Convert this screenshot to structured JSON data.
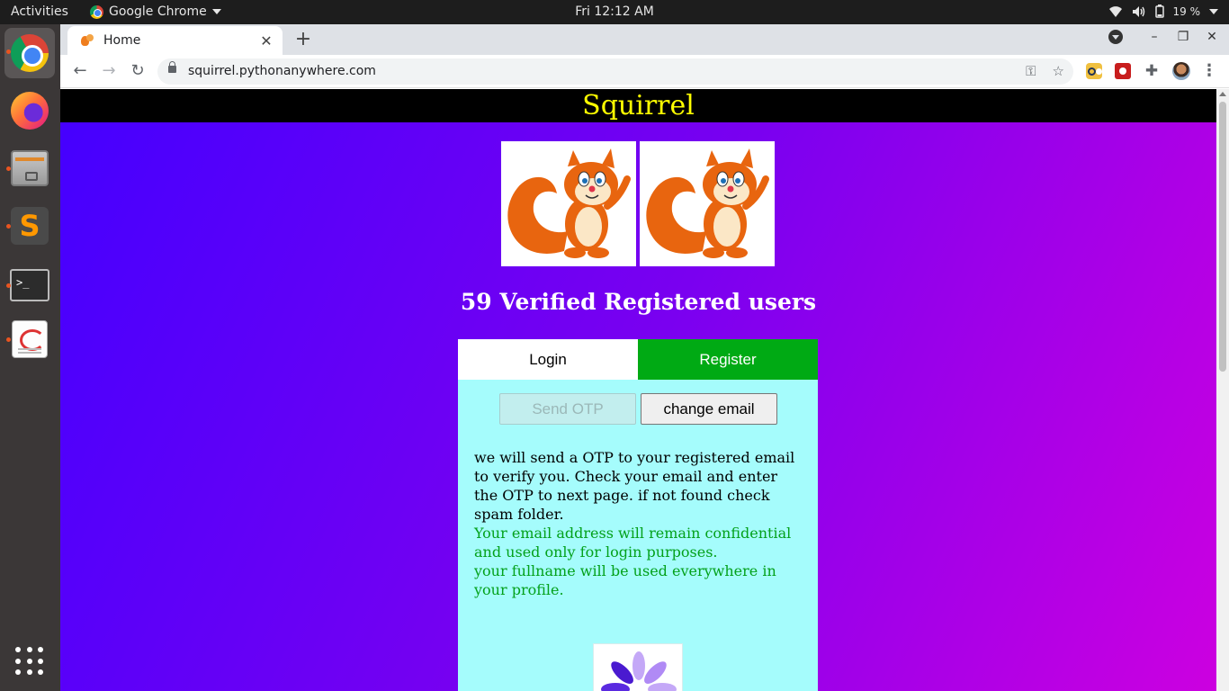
{
  "system": {
    "activities": "Activities",
    "app_name": "Google Chrome",
    "clock": "Fri 12:12 AM",
    "battery": "19 %"
  },
  "dock": {
    "apps": [
      "chrome",
      "firefox",
      "files",
      "sublime-text",
      "terminal",
      "text-editor"
    ],
    "terminal_prompt": ">_"
  },
  "browser": {
    "tab_title": "Home",
    "url": "squirrel.pythonanywhere.com"
  },
  "page": {
    "site_title": "Squirrel",
    "user_count": "59 Verified Registered users",
    "tabs": {
      "login": "Login",
      "register": "Register"
    },
    "buttons": {
      "send_otp": "Send OTP",
      "change_email": "change email"
    },
    "info": "we will send a OTP to your registered email to verify you. Check your email and enter the OTP to next page. if not found check spam folder.",
    "privacy_line1": "Your email address will remain confidential and used only for login purposes.",
    "privacy_line2": "your fullname will be used everywhere in your profile."
  },
  "colors": {
    "header_text": "#ffff00",
    "register_tab": "#00aa14",
    "card_bg": "#a5fcfc",
    "privacy_text": "#03a11b",
    "accent_dot": "#e95420"
  }
}
